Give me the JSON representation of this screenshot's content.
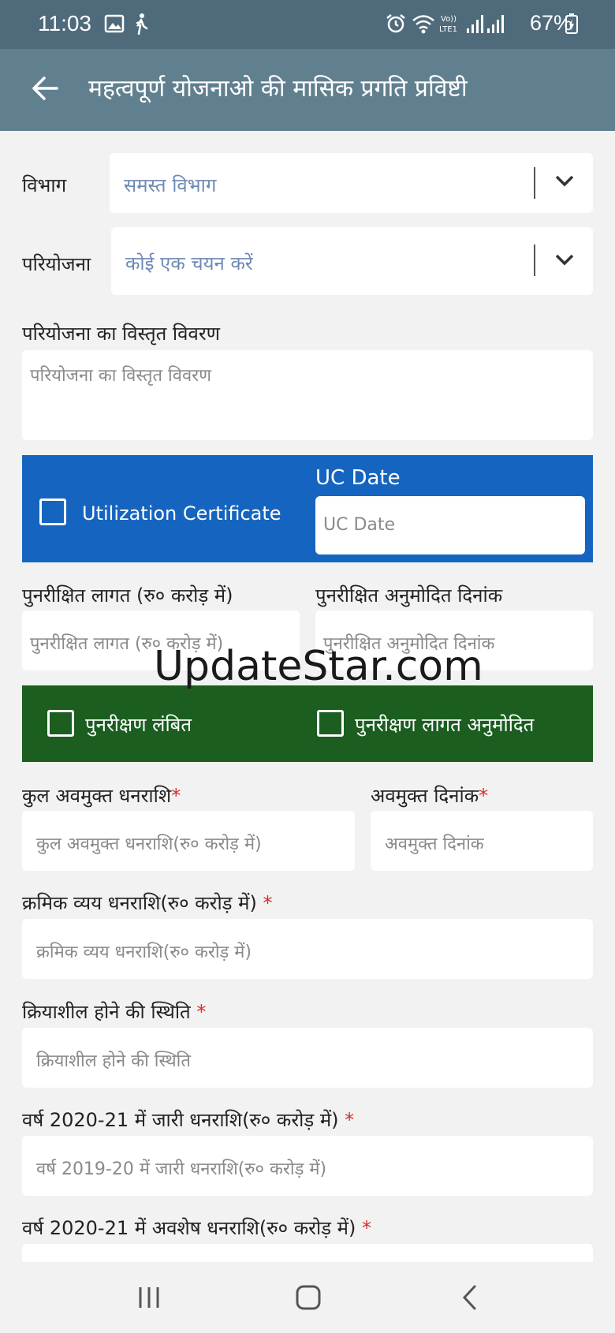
{
  "status_bar": {
    "time": "11:03",
    "battery": "67%"
  },
  "app_bar": {
    "title": "महत्वपूर्ण योजनाओ की मासिक प्रगति प्रविष्टी"
  },
  "form": {
    "department": {
      "label": "विभाग",
      "placeholder": "समस्त विभाग"
    },
    "project": {
      "label": "परियोजना",
      "placeholder": "कोई एक चयन करें"
    },
    "project_details": {
      "label": "परियोजना का विस्तृत विवरण",
      "placeholder": "परियोजना का विस्तृत विवरण"
    },
    "uc_panel": {
      "checkbox_label": "Utilization Certificate",
      "date_label": "UC Date",
      "date_placeholder": "UC Date"
    },
    "revised_cost": {
      "label": "पुनरीक्षित लागत (रु० करोड़ में)",
      "placeholder": "पुनरीक्षित लागत (रु० करोड़ में)"
    },
    "revised_approved_date": {
      "label": "पुनरीक्षित अनुमोदित दिनांक",
      "placeholder": "पुनरीक्षित अनुमोदित दिनांक"
    },
    "revision_panel": {
      "pending_label": "पुनरीक्षण लंबित",
      "approved_label": "पुनरीक्षण लागत अनुमोदित"
    },
    "total_released": {
      "label": "कुल अवमुक्त धनराशि",
      "required": "*",
      "placeholder": "कुल अवमुक्त धनराशि(रु० करोड़ में)"
    },
    "released_date": {
      "label": "अवमुक्त दिनांक",
      "required": "*",
      "placeholder": "अवमुक्त दिनांक"
    },
    "cumulative_expense": {
      "label": "क्रमिक व्यय धनराशि(रु० करोड़ में) ",
      "required": "*",
      "placeholder": "क्रमिक व्यय धनराशि(रु० करोड़ में)"
    },
    "functional_status": {
      "label": "क्रियाशील होने की स्थिति ",
      "required": "*",
      "placeholder": "क्रियाशील होने की स्थिति"
    },
    "year_released": {
      "label": "वर्ष 2020-21 में जारी धनराशि(रु० करोड़ में) ",
      "required": "*",
      "placeholder": "वर्ष 2019-20 में जारी धनराशि(रु० करोड़ में)"
    },
    "year_balance": {
      "label": "वर्ष 2020-21 में अवशेष धनराशि(रु० करोड़ में) ",
      "required": "*"
    }
  },
  "watermark": "UpdateStar.com",
  "icons": {
    "back": "arrow-left-icon",
    "dropdown": "chevron-down-icon"
  },
  "colors": {
    "status_bar": "#4f6b7b",
    "app_bar": "#61808f",
    "uc_panel": "#1565c0",
    "revision_panel": "#1b5e20",
    "required": "#d32f2f"
  }
}
